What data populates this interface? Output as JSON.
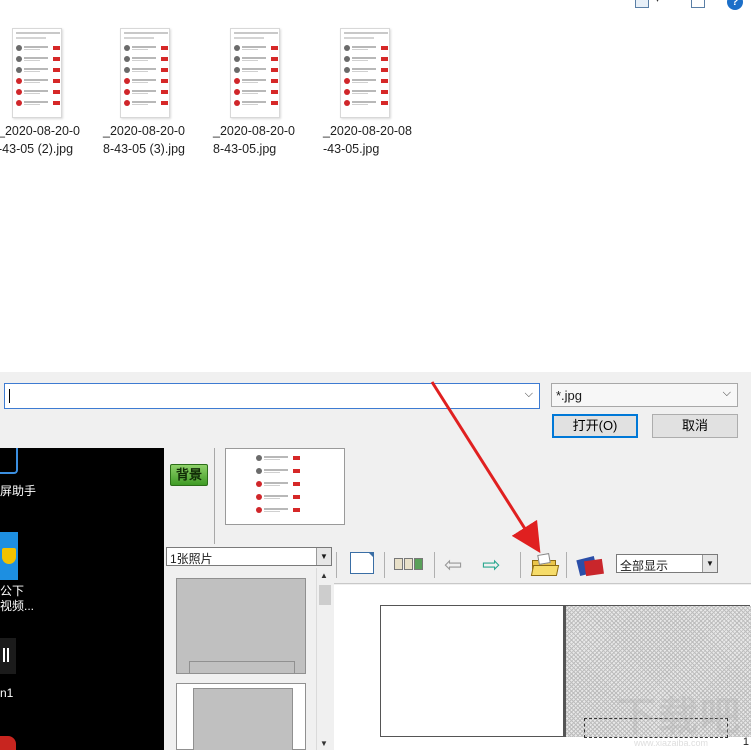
{
  "dialog": {
    "files": [
      {
        "name": "_2020-08-20-0\n-43-05 (2).jpg"
      },
      {
        "name": "_2020-08-20-0\n8-43-05 (3).jpg"
      },
      {
        "name": "_2020-08-20-0\n8-43-05.jpg"
      },
      {
        "name": "_2020-08-20-08\n-43-05.jpg"
      }
    ],
    "filename_value": "",
    "file_type": "*.jpg",
    "open_label": "打开(O)",
    "cancel_label": "取消",
    "help_label": "?"
  },
  "desktop": {
    "labels": [
      "屏助手",
      "公下\n视频...",
      "n1"
    ]
  },
  "app": {
    "background_button": "背景",
    "photo_count_select": "1张照片",
    "zoom_select": "全部显示",
    "page_number": "1"
  },
  "icons": {
    "nav_left": "arrow-left-icon",
    "nav_right": "arrow-right-icon",
    "open_folder": "open-folder-icon",
    "album": "album-icon"
  },
  "colors": {
    "accent_blue": "#0078d7",
    "annotation_red": "#e02020",
    "bg_button_green": "#4ea52d"
  },
  "watermark": {
    "text": "下载吧",
    "url": "www.xiazaiba.com"
  }
}
